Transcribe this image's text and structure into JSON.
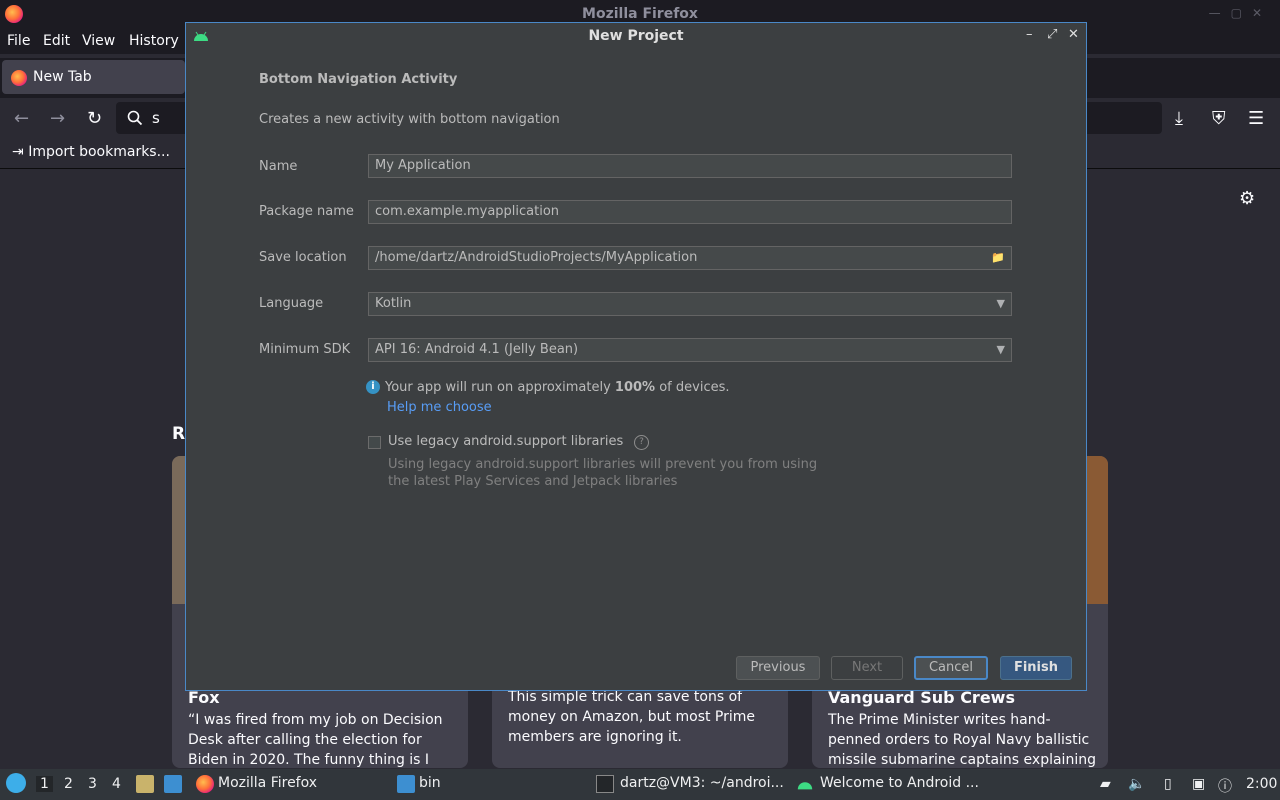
{
  "firefox": {
    "window_title": "Mozilla Firefox",
    "menu": [
      "File",
      "Edit",
      "View",
      "History"
    ],
    "tab_label": "New Tab",
    "url_text": "s",
    "bookmark_label": "Import bookmarks...",
    "section_heading_fragment": "R",
    "cards": [
      {
        "title": "Fox",
        "text": "“I was fired from my job on Decision Desk after calling the election for Biden in 2020. The funny thing is I should have…"
      },
      {
        "title": "",
        "text": "This simple trick can save tons of money on Amazon, but most Prime members are ignoring it."
      },
      {
        "title": "Vanguard Sub Crews",
        "text": "The Prime Minister writes hand-penned orders to Royal Navy ballistic missile submarine captains explaining what to …"
      }
    ]
  },
  "dialog": {
    "title": "New Project",
    "heading": "Bottom Navigation Activity",
    "description": "Creates a new activity with bottom navigation",
    "fields": {
      "name": {
        "label": "Name",
        "value": "My Application"
      },
      "package": {
        "label": "Package name",
        "value": "com.example.myapplication"
      },
      "save_location": {
        "label": "Save location",
        "value": "/home/dartz/AndroidStudioProjects/MyApplication"
      },
      "language": {
        "label": "Language",
        "value": "Kotlin"
      },
      "min_sdk": {
        "label": "Minimum SDK",
        "value": "API 16: Android 4.1 (Jelly Bean)"
      }
    },
    "info": {
      "prefix": "Your app will run on approximately ",
      "percent": "100%",
      "suffix": " of devices."
    },
    "help_link": "Help me choose",
    "legacy_checkbox": {
      "label": "Use legacy android.support libraries",
      "checked": false,
      "note_line1": "Using legacy android.support libraries will prevent you from using",
      "note_line2": "the latest Play Services and Jetpack libraries"
    },
    "buttons": {
      "previous": "Previous",
      "next": "Next",
      "cancel": "Cancel",
      "finish": "Finish"
    }
  },
  "taskbar": {
    "workspaces": [
      "1",
      "2",
      "3",
      "4"
    ],
    "tasks": [
      {
        "label": "Mozilla Firefox"
      },
      {
        "label": "bin"
      },
      {
        "label": "dartz@VM3: ~/androi..."
      },
      {
        "label": "Welcome to Android ..."
      }
    ],
    "clock": "2:00"
  },
  "colors": {
    "accent": "#4a88c7",
    "link": "#589df6",
    "primary_button": "#365880",
    "dialog_bg": "#3c3f41"
  }
}
